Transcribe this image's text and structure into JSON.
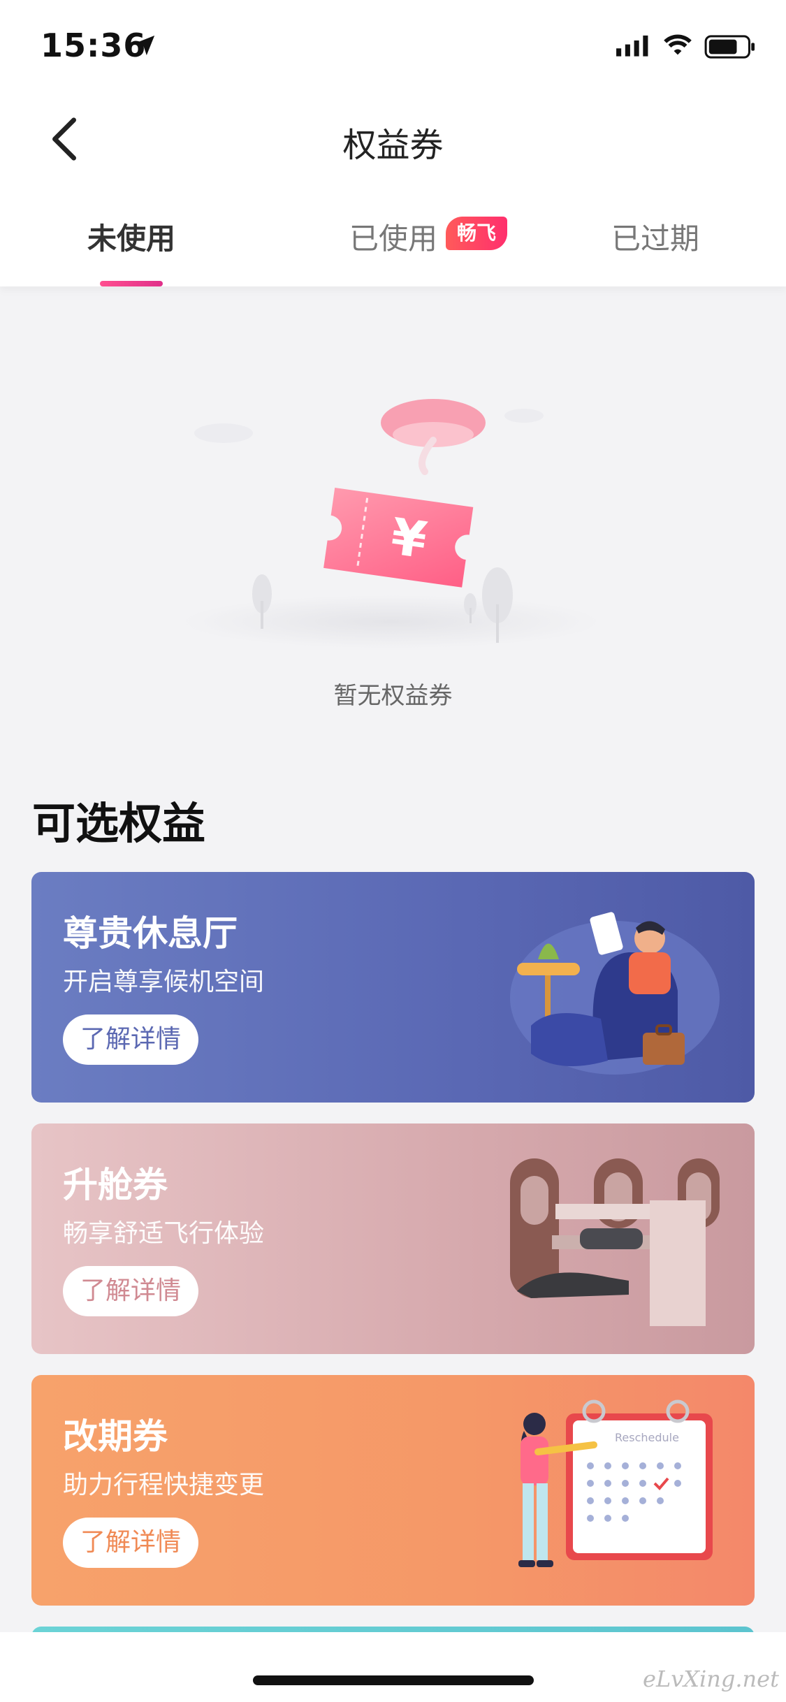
{
  "status": {
    "time": "15:36"
  },
  "nav": {
    "title": "权益券"
  },
  "tabs": [
    {
      "label": "未使用",
      "active": true
    },
    {
      "label": "已使用",
      "active": false,
      "badge": "畅飞"
    },
    {
      "label": "已过期",
      "active": false
    }
  ],
  "empty": {
    "text": "暂无权益券"
  },
  "section": {
    "title": "可选权益"
  },
  "cards": [
    {
      "title": "尊贵休息厅",
      "subtitle": "开启尊享候机空间",
      "button": "了解详情"
    },
    {
      "title": "升舱券",
      "subtitle": "畅享舒适飞行体验",
      "button": "了解详情"
    },
    {
      "title": "改期券",
      "subtitle": "助力行程快捷变更",
      "button": "了解详情",
      "illustration_text": "Reschedule"
    }
  ],
  "watermark": "eLvXing.net",
  "colors": {
    "accent": "#e0308a",
    "lounge": "#5a68b4",
    "upgrade": "#d6a9ad",
    "change": "#f59868"
  },
  "icons": [
    "location-arrow-icon",
    "signal-icon",
    "wifi-icon",
    "battery-icon",
    "back-icon"
  ]
}
